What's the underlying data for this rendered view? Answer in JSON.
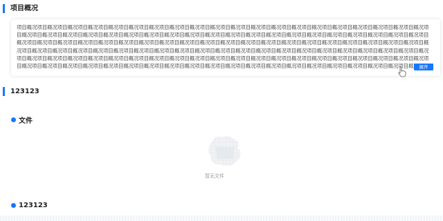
{
  "overview": {
    "title": "项目概况",
    "text": "项目概况项目概况项目概况项目概况项目概况项目概况项目概况项目概况项目概况项目概况项目概况项目概况项目概况项目概况项目概况项目概况项目概况项目概况项目概况项目概况项目概况项目概况项目概况项目概况项目概况项目概况项目概况项目概况项目概况项目概况项目概况项目概况项目概况项目概况项目概况项目概况项目概况项目概况项目概况项目概况项目概况项目概况项目概况项目概况项目概况项目概况项目概况项目概况项目概况项目概况项目概况项目概况项目概况项目概况项目概况项目概况项目概况项目概况项目概况项目概况项目概况项目概况项目概况项目概况项目概况项目概况项目概况项目概况项目概况项目概况项目概况项目概况项目概况项目概况项目概况项目概况项目概况项目概况项目概况项目概况项目概况项目概况项目概况项目概况项目概况项目概况项目概况项目概况项目概况项目概况项目概况项目概况项目概况项目概况项目概况项目概况项目概况项目概况项目概况项目概况项目概况项目概况项目概况项目概况项目概况项目概况项目概况项目概况项目概况项目概况项目概况项目概况项目概况项目概况项目概况项目概况项目概况项目概况项目概况项目概况项目概况项目概况",
    "expand_label": "展开"
  },
  "section2": {
    "title": "123123"
  },
  "files": {
    "title": "文件",
    "empty_text": "暂无文件"
  },
  "section4": {
    "title": "123123"
  },
  "colors": {
    "accent": "#1677ff"
  },
  "icons": {
    "cursor": "hand-pointer-icon",
    "empty": "empty-box-icon"
  }
}
